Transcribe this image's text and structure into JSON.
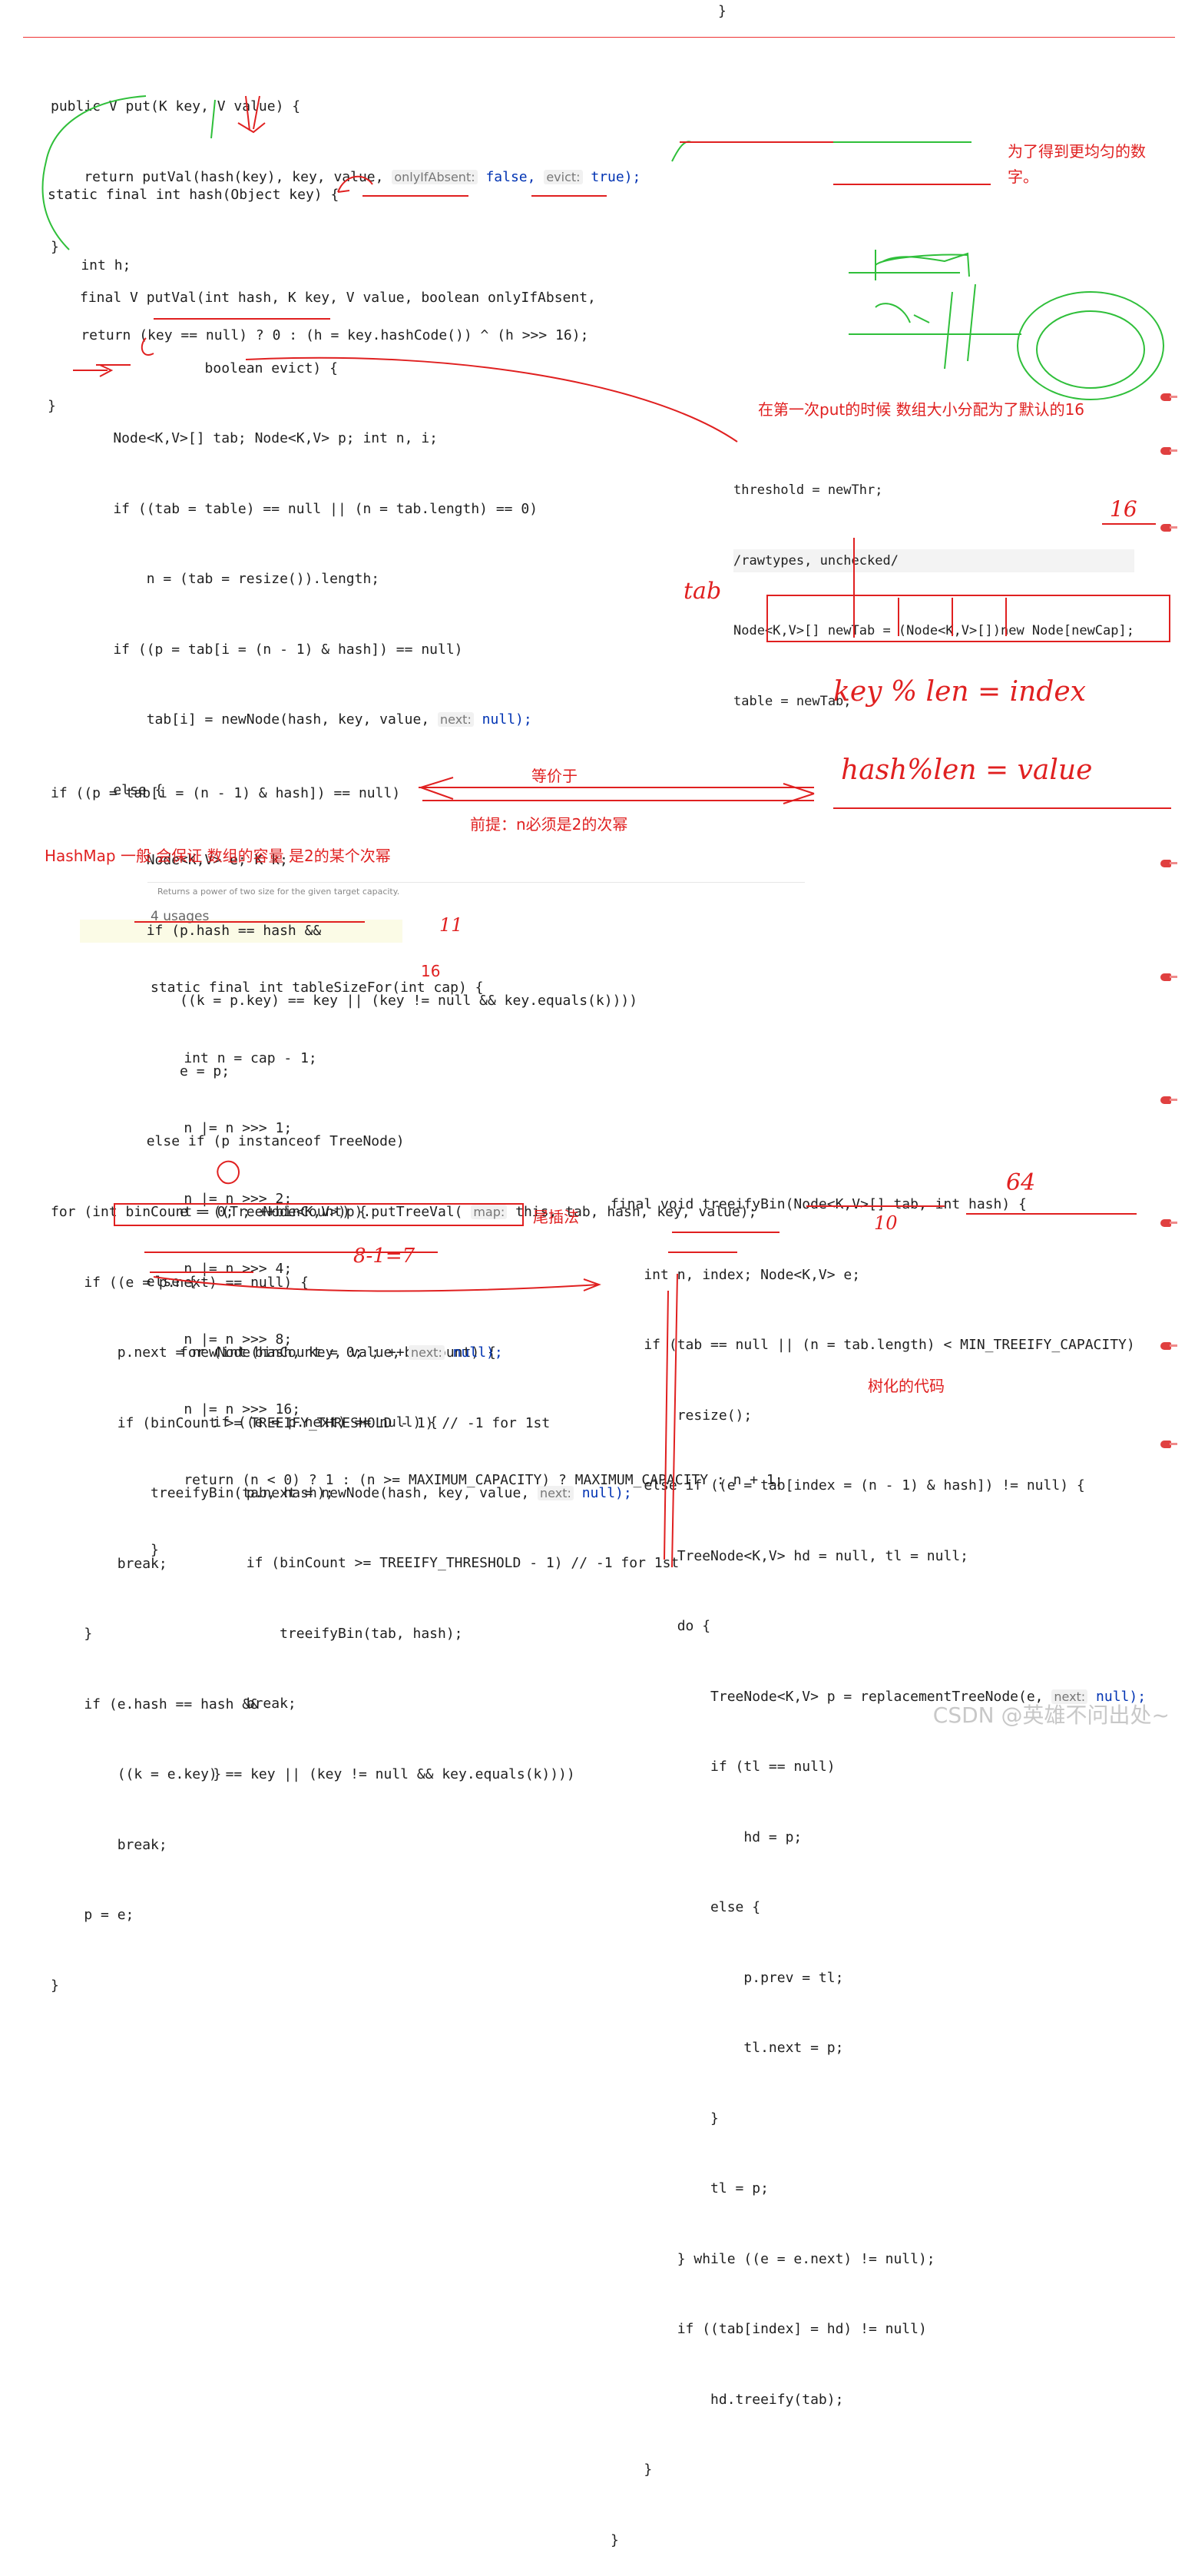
{
  "top_brace": "}",
  "put_code": [
    "public V put(K key, V value) {",
    "    return putVal(hash(key), key, value, ",
    "}"
  ],
  "put_hints": {
    "only_if_absent": "onlyIfAbsent:",
    "only_if_absent_val": " false,",
    "evict": "evict:",
    "evict_val": " true);"
  },
  "hash_code": [
    "static final int hash(Object key) {",
    "    int h;",
    "    return (key == null) ? 0 : (h = key.hashCode()) ^ (h >>> 16);",
    "}"
  ],
  "putval_code": [
    "final V putVal(int hash, K key, V value, boolean onlyIfAbsent,",
    "               boolean evict) {",
    "    Node<K,V>[] tab; Node<K,V> p; int n, i;",
    "    if ((tab = table) == null || (n = tab.length) == 0)",
    "        n = (tab = resize()).length;",
    "    if ((p = tab[i = (n - 1) & hash]) == null)",
    "        tab[i] = newNode(hash, key, value, ",
    "    else {",
    "        Node<K,V> e; K k;",
    "        if (p.hash == hash &&",
    "            ((k = p.key) == key || (key != null && key.equals(k))))",
    "            e = p;",
    "        else if (p instanceof TreeNode)",
    "            e = ((TreeNode<K,V>)p).putTreeVal( ",
    "        else {",
    "            for (int binCount = 0; ; ++binCount) {",
    "                if ((e = p.next) == null) {",
    "                    p.next = newNode(hash, key, value, ",
    "                    if (binCount >= TREEIFY_THRESHOLD - 1) // -1 for 1st",
    "                        treeifyBin(tab, hash);",
    "                    break;",
    "                }"
  ],
  "putval_hints": {
    "next_null": "next:",
    "next_null_val": " null);",
    "map_this": "map:",
    "map_this_val": " this, tab, hash, key, value);"
  },
  "resize_snippet": [
    "threshold = newThr;",
    "/rawtypes, unchecked/",
    "Node<K,V>[] newTab = (Node<K,V>[])new Node[newCap];",
    "table = newTab;"
  ],
  "equiv_line": "if ((p = tab[i = (n - 1) & hash]) == null)",
  "table_size_doc": "Returns a power of two size for the given target capacity.",
  "usages": "4 usages",
  "table_size_code": [
    "static final int tableSizeFor(int cap) {",
    "    int n = cap - 1;",
    "    n |= n >>> 1;",
    "    n |= n >>> 2;",
    "    n |= n >>> 4;",
    "    n |= n >>> 8;",
    "    n |= n >>> 16;",
    "    return (n < 0) ? 1 : (n >= MAXIMUM_CAPACITY) ? MAXIMUM_CAPACITY : n + 1;",
    "}"
  ],
  "for_loop_code": [
    "for (int binCount = 0; ; ++binCount) {",
    "    if ((e = p.next) == null) {",
    "        p.next = newNode(hash, key, value, ",
    "        if (binCount >= TREEIFY_THRESHOLD - 1) // -1 for 1st",
    "            treeifyBin(tab, hash);",
    "        break;",
    "    }",
    "    if (e.hash == hash &&",
    "        ((k = e.key) == key || (key != null && key.equals(k))))",
    "        break;",
    "    p = e;",
    "}"
  ],
  "treeify_code": [
    "final void treeifyBin(Node<K,V>[] tab, int hash) {",
    "    int n, index; Node<K,V> e;",
    "    if (tab == null || (n = tab.length) < MIN_TREEIFY_CAPACITY)",
    "        resize();",
    "    else if ((e = tab[index = (n - 1) & hash]) != null) {",
    "        TreeNode<K,V> hd = null, tl = null;",
    "        do {",
    "            TreeNode<K,V> p = replacementTreeNode(e, ",
    "            if (tl == null)",
    "                hd = p;",
    "            else {",
    "                p.prev = tl;",
    "                tl.next = p;",
    "            }",
    "            tl = p;",
    "        } while ((e = e.next) != null);",
    "        if ((tab[index] = hd) != null)",
    "            hd.treeify(tab);",
    "    }",
    "}"
  ],
  "notes": {
    "uniform": "为了得到更均匀的数",
    "uniform2": "字。",
    "first_put": "在第一次put的时候 数组大小分配为了默认的16",
    "equiv": "等价于",
    "premise": "前提：n必须是2的次幂",
    "power_of_two": "HashMap 一般 会保证 数组的容量 是2的某个次幂",
    "tail_insert": "尾插法",
    "treeify": "树化的代码",
    "sixteen_a": "16",
    "sixteen_b": "16"
  },
  "handwriting": {
    "hw_16": "16",
    "hw_tab": "tab",
    "hw_key_mod": "key % len = index",
    "hw_hash_mod": "hash%len = value",
    "hw_11": "11",
    "hw_8_1_7": "8-1=7",
    "hw_64": "64",
    "hw_10": "10"
  },
  "watermark": "CSDN @英雄不问出处~"
}
